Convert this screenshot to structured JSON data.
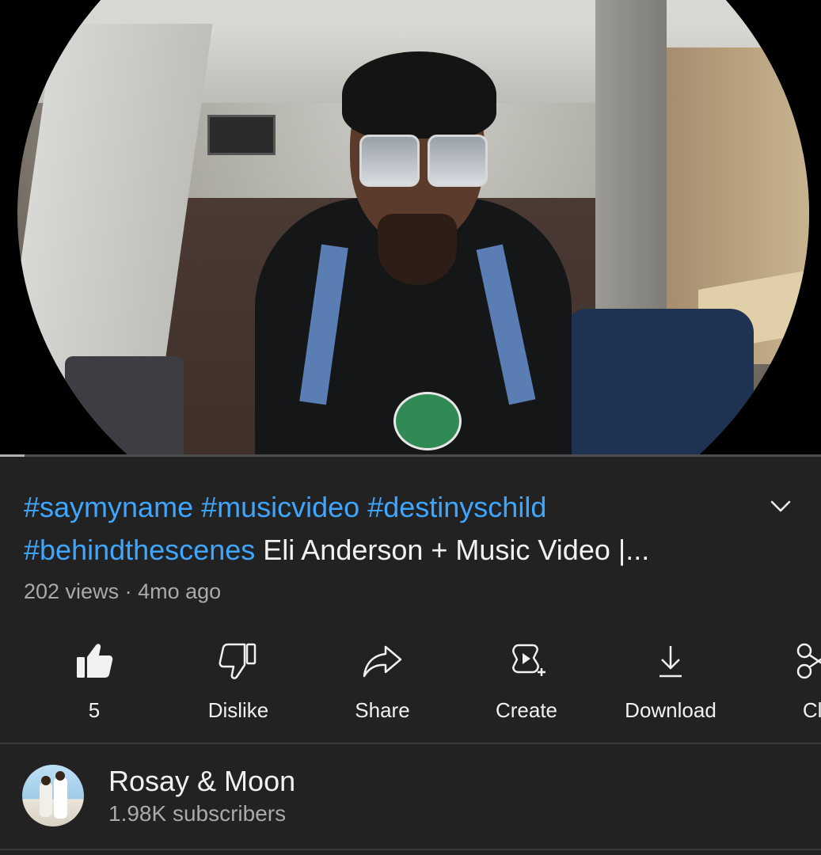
{
  "video": {
    "progress": 0.03
  },
  "title": {
    "hashtags": [
      "#saymyname",
      "#musicvideo",
      "#destinyschild",
      "#behindthescenes"
    ],
    "text": "Eli Anderson + Music Video |..."
  },
  "meta": {
    "views": "202 views",
    "separator": "·",
    "age": "4mo ago"
  },
  "actions": [
    {
      "id": "like",
      "label": "5",
      "icon": "thumbs-up-icon"
    },
    {
      "id": "dislike",
      "label": "Dislike",
      "icon": "thumbs-down-icon"
    },
    {
      "id": "share",
      "label": "Share",
      "icon": "share-icon"
    },
    {
      "id": "create",
      "label": "Create",
      "icon": "create-icon"
    },
    {
      "id": "download",
      "label": "Download",
      "icon": "download-icon"
    },
    {
      "id": "clip",
      "label": "Cli",
      "icon": "scissors-icon"
    }
  ],
  "channel": {
    "name": "Rosay & Moon",
    "subscribers": "1.98K subscribers"
  },
  "colors": {
    "background": "#222222",
    "hashtag": "#3ea6ff",
    "text": "#f1f1f1",
    "secondary_text": "#aaaaaa"
  }
}
